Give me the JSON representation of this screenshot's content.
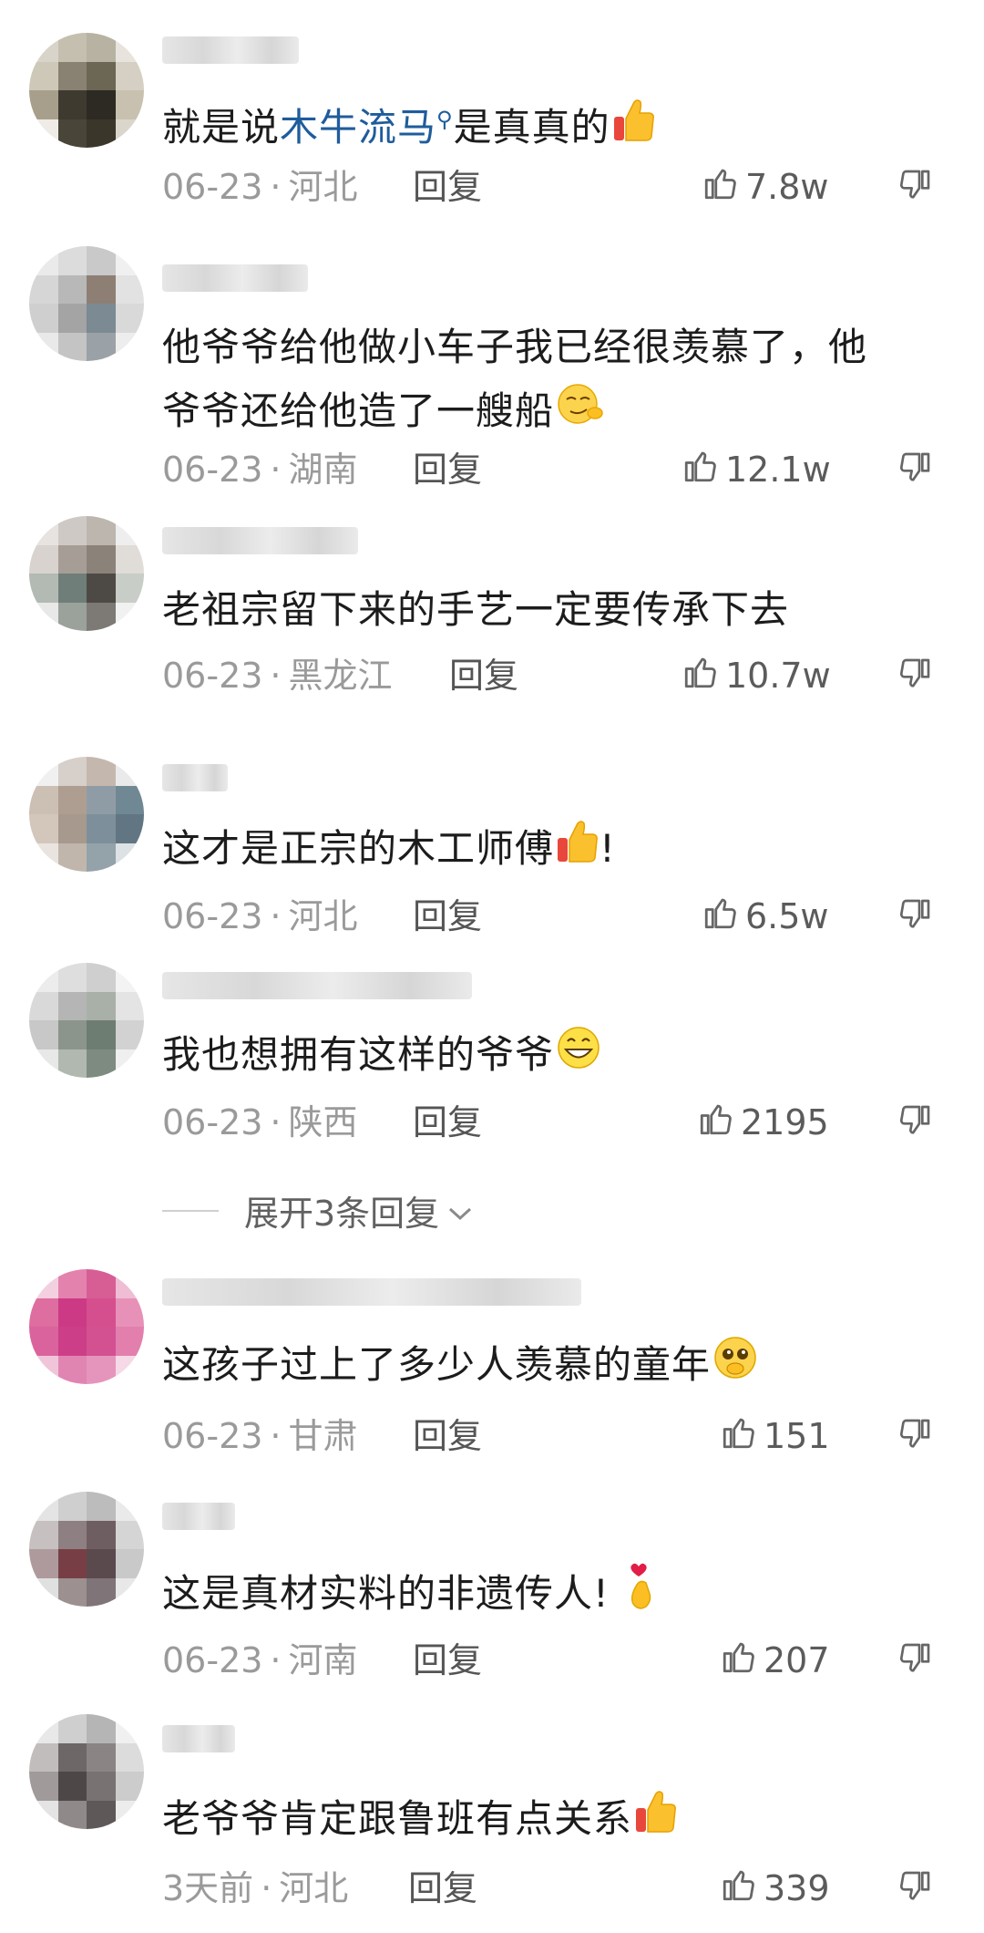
{
  "comments": [
    {
      "text_before": "就是说",
      "link": "木牛流马",
      "text_after": "是真真的",
      "date": "06-23",
      "location": "河北",
      "reply": "回复",
      "likes": "7.8w",
      "emoji": "thumbs-up-emoji"
    },
    {
      "text_line1": "他爷爷给他做小车子我已经很羡慕了，他",
      "text_line2": "爷爷还给他造了一艘船",
      "date": "06-23",
      "location": "湖南",
      "reply": "回复",
      "likes": "12.1w",
      "emoji": "smug-face-emoji"
    },
    {
      "text": "老祖宗留下来的手艺一定要传承下去",
      "date": "06-23",
      "location": "黑龙江",
      "reply": "回复",
      "likes": "10.7w"
    },
    {
      "text": "这才是正宗的木工师傅",
      "text_after": "!",
      "date": "06-23",
      "location": "河北",
      "reply": "回复",
      "likes": "6.5w",
      "emoji": "thumbs-up-emoji"
    },
    {
      "text": "我也想拥有这样的爷爷",
      "date": "06-23",
      "location": "陕西",
      "reply": "回复",
      "likes": "2195",
      "emoji": "grinning-face-emoji"
    },
    {
      "text": "这孩子过上了多少人羡慕的童年",
      "date": "06-23",
      "location": "甘肃",
      "reply": "回复",
      "likes": "151",
      "emoji": "pleading-face-emoji"
    },
    {
      "text": "这是真材实料的非遗传人!",
      "date": "06-23",
      "location": "河南",
      "reply": "回复",
      "likes": "207",
      "emoji": "finger-heart-emoji"
    },
    {
      "text": "老爷爷肯定跟鲁班有点关系",
      "date": "3天前",
      "location": "河北",
      "reply": "回复",
      "likes": "339",
      "emoji": "thumbs-up-emoji"
    }
  ],
  "expand_replies": "展开3条回复",
  "separator": "·"
}
